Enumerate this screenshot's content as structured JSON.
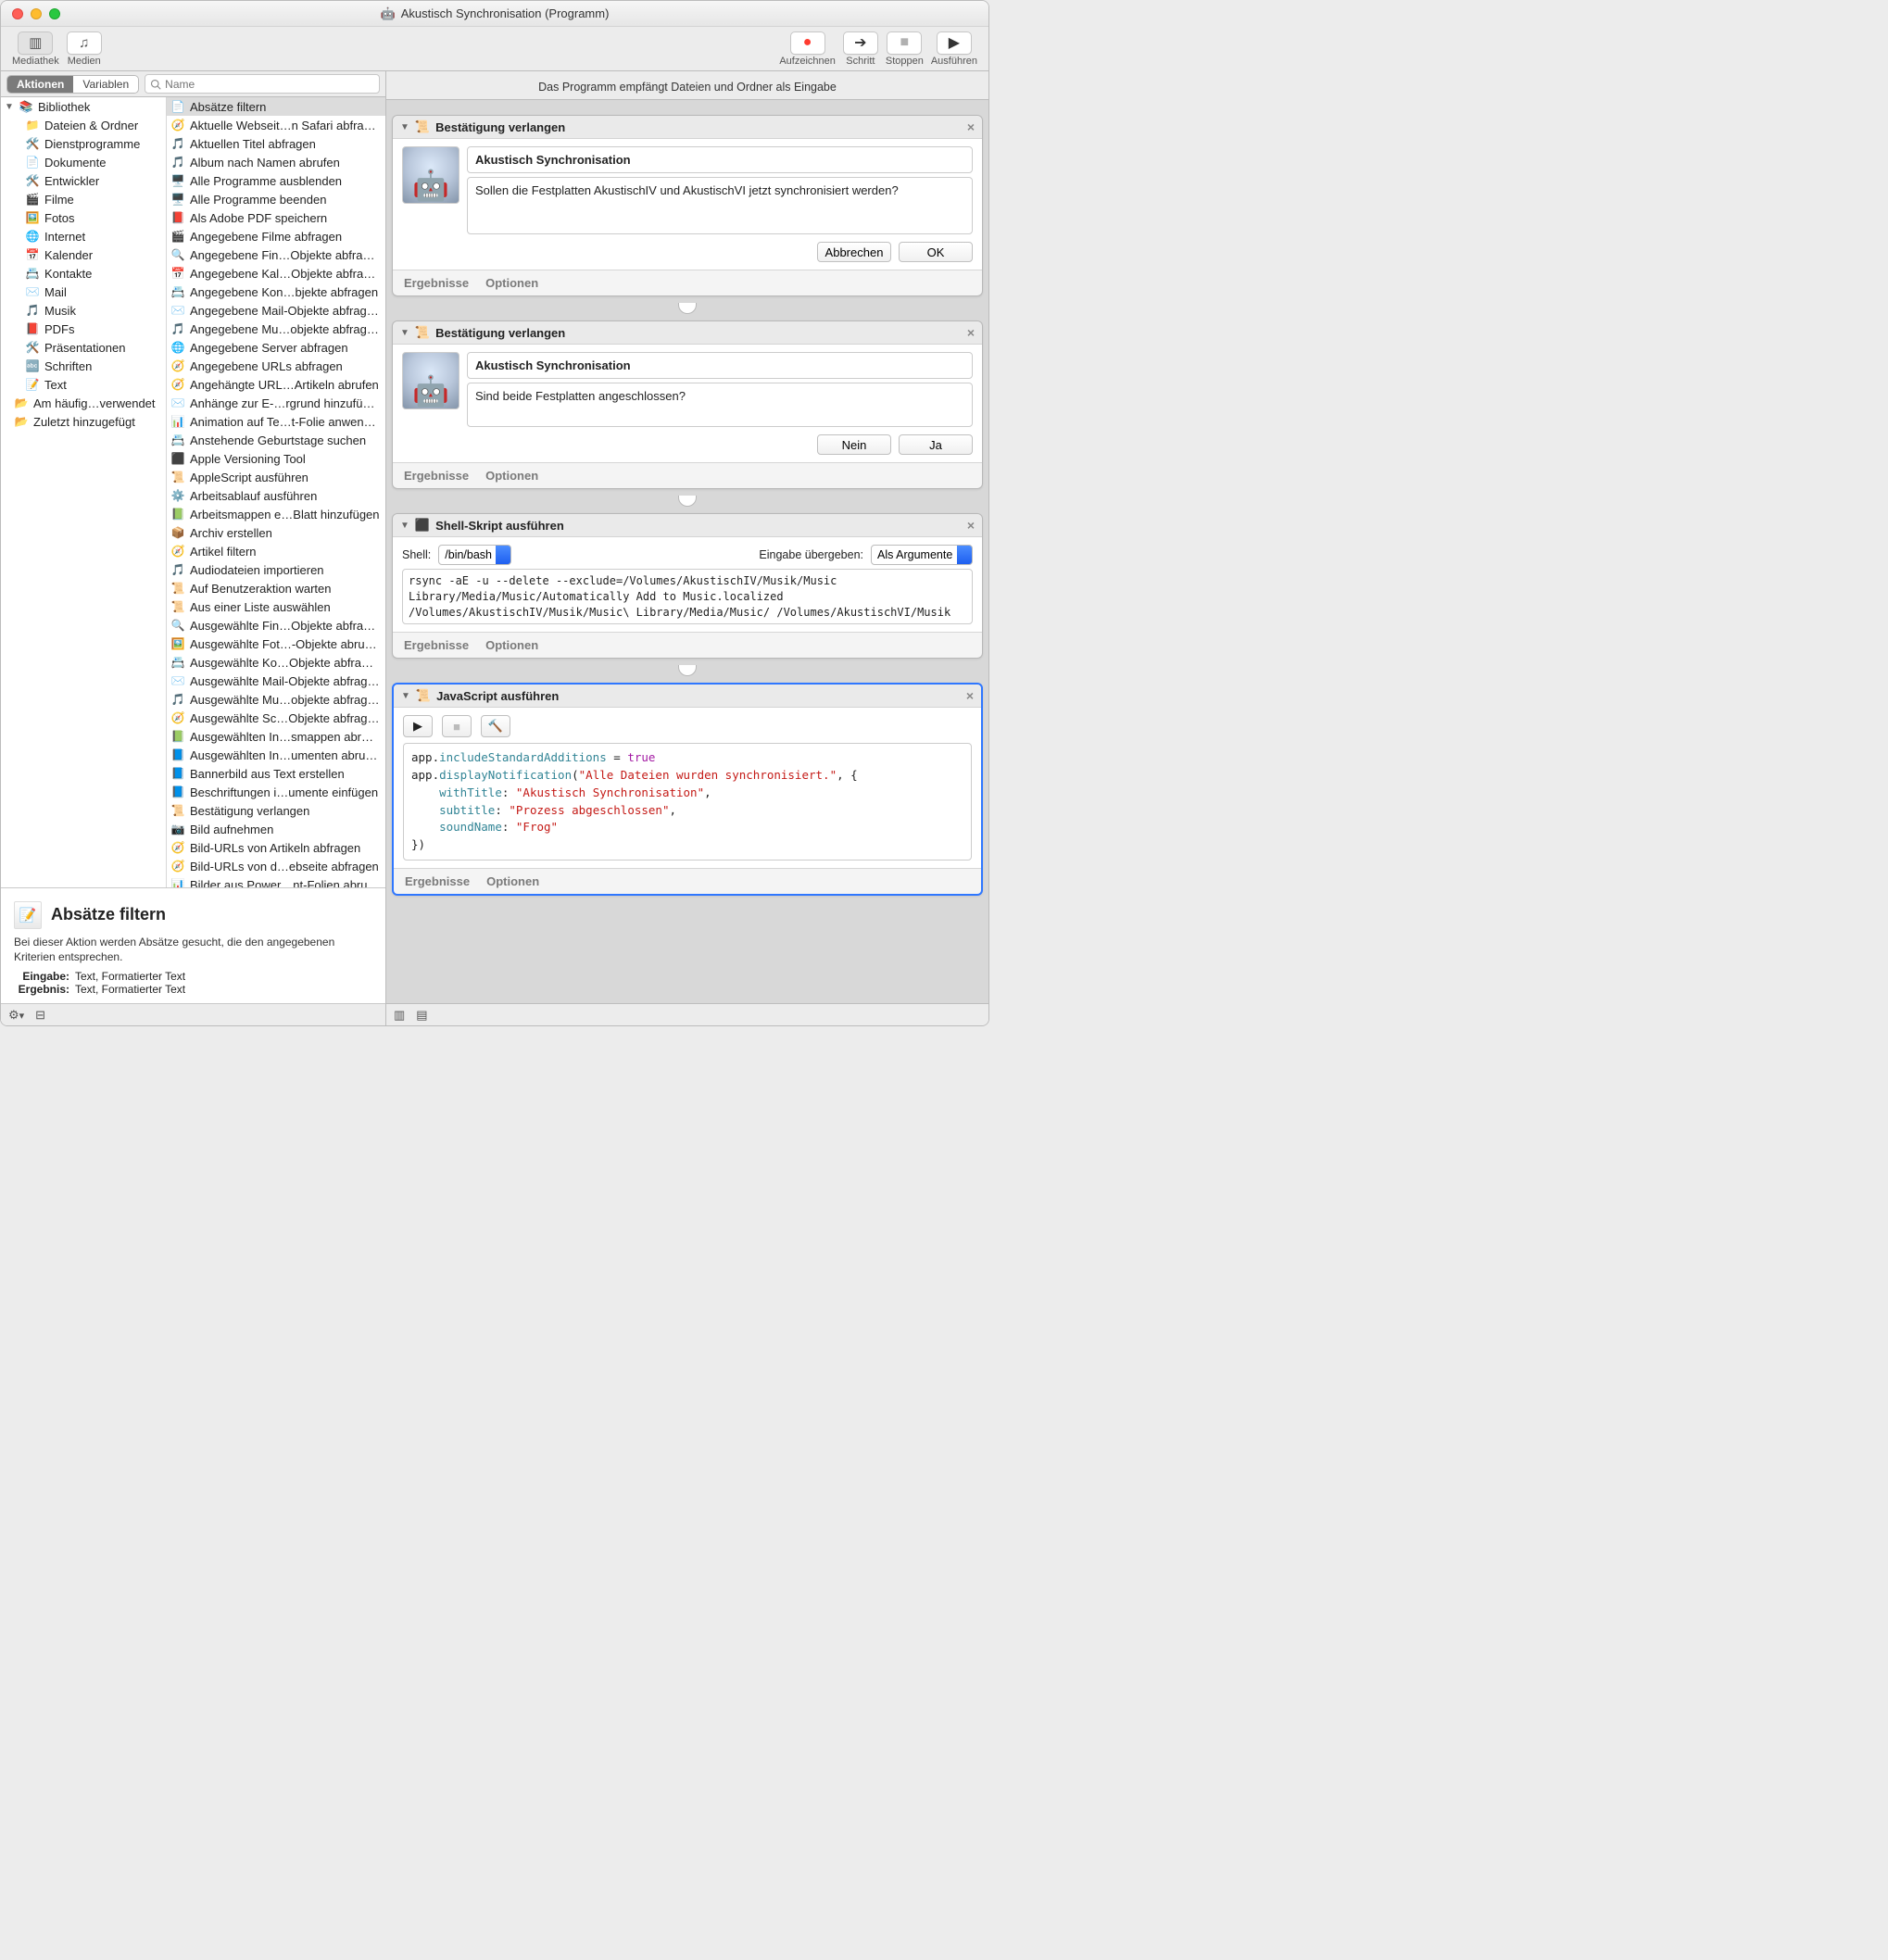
{
  "window": {
    "title": "Akustisch Synchronisation (Programm)"
  },
  "toolbar_left": [
    {
      "label": "Mediathek",
      "name": "library-toggle-button",
      "glyph": "▥"
    },
    {
      "label": "Medien",
      "name": "media-toggle-button",
      "glyph": "♫"
    }
  ],
  "toolbar_right": [
    {
      "label": "Aufzeichnen",
      "name": "record-button",
      "color": "#ff3b30",
      "glyph": "●"
    },
    {
      "label": "Schritt",
      "name": "step-button",
      "color": "#333",
      "glyph": "➔"
    },
    {
      "label": "Stoppen",
      "name": "stop-button",
      "color": "#b0b0b0",
      "glyph": "■"
    },
    {
      "label": "Ausführen",
      "name": "run-button",
      "color": "#333",
      "glyph": "▶"
    }
  ],
  "tabs": {
    "actions": "Aktionen",
    "variables": "Variablen",
    "search_placeholder": "Name"
  },
  "library": {
    "header": "Bibliothek",
    "items": [
      {
        "icon": "📁",
        "label": "Dateien & Ordner"
      },
      {
        "icon": "🛠️",
        "label": "Dienstprogramme"
      },
      {
        "icon": "📄",
        "label": "Dokumente"
      },
      {
        "icon": "🛠️",
        "label": "Entwickler"
      },
      {
        "icon": "🎬",
        "label": "Filme"
      },
      {
        "icon": "🖼️",
        "label": "Fotos"
      },
      {
        "icon": "🌐",
        "label": "Internet"
      },
      {
        "icon": "📅",
        "label": "Kalender"
      },
      {
        "icon": "📇",
        "label": "Kontakte"
      },
      {
        "icon": "✉️",
        "label": "Mail"
      },
      {
        "icon": "🎵",
        "label": "Musik"
      },
      {
        "icon": "📕",
        "label": "PDFs"
      },
      {
        "icon": "🛠️",
        "label": "Präsentationen"
      },
      {
        "icon": "🔤",
        "label": "Schriften"
      },
      {
        "icon": "📝",
        "label": "Text"
      }
    ],
    "tail": [
      {
        "icon": "📂",
        "label": "Am häufig…verwendet"
      },
      {
        "icon": "📂",
        "label": "Zuletzt hinzugefügt"
      }
    ]
  },
  "actions": [
    {
      "icon": "📄",
      "label": "Absätze filtern",
      "selected": true
    },
    {
      "icon": "🧭",
      "label": "Aktuelle Webseit…n Safari abfragen"
    },
    {
      "icon": "🎵",
      "label": "Aktuellen Titel abfragen"
    },
    {
      "icon": "🎵",
      "label": "Album nach Namen abrufen"
    },
    {
      "icon": "🖥️",
      "label": "Alle Programme ausblenden"
    },
    {
      "icon": "🖥️",
      "label": "Alle Programme beenden"
    },
    {
      "icon": "📕",
      "label": "Als Adobe PDF speichern"
    },
    {
      "icon": "🎬",
      "label": "Angegebene Filme abfragen"
    },
    {
      "icon": "🔍",
      "label": "Angegebene Fin…Objekte abfragen"
    },
    {
      "icon": "📅",
      "label": "Angegebene Kal…Objekte abfragen"
    },
    {
      "icon": "📇",
      "label": "Angegebene Kon…bjekte abfragen"
    },
    {
      "icon": "✉️",
      "label": "Angegebene Mail-Objekte abfragen"
    },
    {
      "icon": "🎵",
      "label": "Angegebene Mu…objekte abfragen"
    },
    {
      "icon": "🌐",
      "label": "Angegebene Server abfragen"
    },
    {
      "icon": "🧭",
      "label": "Angegebene URLs abfragen"
    },
    {
      "icon": "🧭",
      "label": "Angehängte URL…Artikeln abrufen"
    },
    {
      "icon": "✉️",
      "label": "Anhänge zur E-…rgrund hinzufügen"
    },
    {
      "icon": "📊",
      "label": "Animation auf Te…t-Folie anwenden"
    },
    {
      "icon": "📇",
      "label": "Anstehende Geburtstage suchen"
    },
    {
      "icon": "⬛",
      "label": "Apple Versioning Tool"
    },
    {
      "icon": "📜",
      "label": "AppleScript ausführen"
    },
    {
      "icon": "⚙️",
      "label": "Arbeitsablauf ausführen"
    },
    {
      "icon": "📗",
      "label": "Arbeitsmappen e…Blatt hinzufügen"
    },
    {
      "icon": "📦",
      "label": "Archiv erstellen"
    },
    {
      "icon": "🧭",
      "label": "Artikel filtern"
    },
    {
      "icon": "🎵",
      "label": "Audiodateien importieren"
    },
    {
      "icon": "📜",
      "label": "Auf Benutzeraktion warten"
    },
    {
      "icon": "📜",
      "label": "Aus einer Liste auswählen"
    },
    {
      "icon": "🔍",
      "label": "Ausgewählte Fin…Objekte abfragen"
    },
    {
      "icon": "🖼️",
      "label": "Ausgewählte Fot…-Objekte abrufen"
    },
    {
      "icon": "📇",
      "label": "Ausgewählte Ko…Objekte abfragen"
    },
    {
      "icon": "✉️",
      "label": "Ausgewählte Mail-Objekte abfragen"
    },
    {
      "icon": "🎵",
      "label": "Ausgewählte Mu…objekte abfragen"
    },
    {
      "icon": "🧭",
      "label": "Ausgewählte Sc…Objekte abfragen"
    },
    {
      "icon": "📗",
      "label": "Ausgewählten In…smappen abrufen"
    },
    {
      "icon": "📘",
      "label": "Ausgewählten In…umenten abrufen"
    },
    {
      "icon": "📘",
      "label": "Bannerbild aus Text erstellen"
    },
    {
      "icon": "📘",
      "label": "Beschriftungen i…umente einfügen"
    },
    {
      "icon": "📜",
      "label": "Bestätigung verlangen"
    },
    {
      "icon": "📷",
      "label": "Bild aufnehmen"
    },
    {
      "icon": "🧭",
      "label": "Bild-URLs von Artikeln abfragen"
    },
    {
      "icon": "🧭",
      "label": "Bild-URLs von d…ebseite abfragen"
    },
    {
      "icon": "📊",
      "label": "Bilder aus Power…nt-Folien abrufen"
    }
  ],
  "description": {
    "title": "Absätze filtern",
    "body": "Bei dieser Aktion werden Absätze gesucht, die den angegebenen Kriterien entsprechen.",
    "input_label": "Eingabe:",
    "input_value": "Text, Formatierter Text",
    "output_label": "Ergebnis:",
    "output_value": "Text, Formatierter Text"
  },
  "workflow": {
    "header_text": "Das Programm empfängt Dateien und Ordner als Eingabe",
    "results_label": "Ergebnisse",
    "options_label": "Optionen",
    "ask1": {
      "title": "Bestätigung verlangen",
      "box_title": "Akustisch Synchronisation",
      "box_body": "Sollen die Festplatten AkustischIV und AkustischVI jetzt synchronisiert werden?",
      "cancel": "Abbrechen",
      "ok": "OK"
    },
    "ask2": {
      "title": "Bestätigung verlangen",
      "box_title": "Akustisch Synchronisation",
      "box_body": "Sind beide Festplatten angeschlossen?",
      "cancel": "Nein",
      "ok": "Ja"
    },
    "shell": {
      "title": "Shell-Skript ausführen",
      "shell_label": "Shell:",
      "shell_value": "/bin/bash",
      "pass_label": "Eingabe übergeben:",
      "pass_value": "Als Argumente",
      "code": "rsync -aE -u --delete --exclude=/Volumes/AkustischIV/Musik/Music Library/Media/Music/Automatically Add to Music.localized /Volumes/AkustischIV/Musik/Music\\ Library/Media/Music/ /Volumes/AkustischVI/Musik"
    },
    "js": {
      "title": "JavaScript ausführen",
      "code_lines": [
        {
          "plain": "app.includeStandardAdditions = ",
          "tail": "true",
          "tail_cls": "kw"
        },
        {
          "plain": ""
        },
        {
          "plain": "app.displayNotification(",
          "str": "\"Alle Dateien wurden synchronisiert.\"",
          "tail": ", {"
        },
        {
          "indent": 1,
          "plain": "withTitle: ",
          "str": "\"Akustisch Synchronisation\"",
          "tail": ","
        },
        {
          "indent": 1,
          "plain": "subtitle: ",
          "str": "\"Prozess abgeschlossen\"",
          "tail": ","
        },
        {
          "indent": 1,
          "plain": "soundName: ",
          "str": "\"Frog\""
        },
        {
          "plain": "})"
        }
      ]
    }
  }
}
